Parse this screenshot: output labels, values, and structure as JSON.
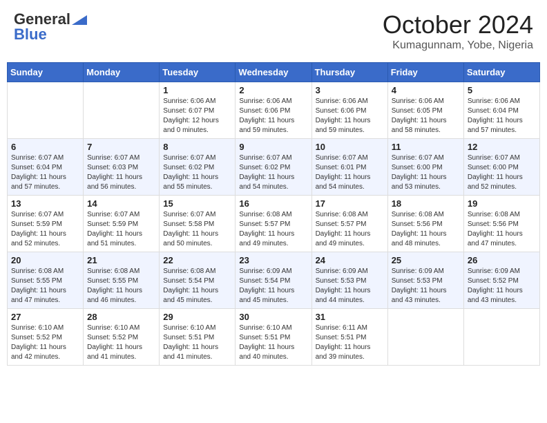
{
  "header": {
    "logo_general": "General",
    "logo_blue": "Blue",
    "month_title": "October 2024",
    "location": "Kumagunnam, Yobe, Nigeria"
  },
  "weekdays": [
    "Sunday",
    "Monday",
    "Tuesday",
    "Wednesday",
    "Thursday",
    "Friday",
    "Saturday"
  ],
  "weeks": [
    [
      {
        "day": "",
        "info": ""
      },
      {
        "day": "",
        "info": ""
      },
      {
        "day": "1",
        "info": "Sunrise: 6:06 AM\nSunset: 6:07 PM\nDaylight: 12 hours\nand 0 minutes."
      },
      {
        "day": "2",
        "info": "Sunrise: 6:06 AM\nSunset: 6:06 PM\nDaylight: 11 hours\nand 59 minutes."
      },
      {
        "day": "3",
        "info": "Sunrise: 6:06 AM\nSunset: 6:06 PM\nDaylight: 11 hours\nand 59 minutes."
      },
      {
        "day": "4",
        "info": "Sunrise: 6:06 AM\nSunset: 6:05 PM\nDaylight: 11 hours\nand 58 minutes."
      },
      {
        "day": "5",
        "info": "Sunrise: 6:06 AM\nSunset: 6:04 PM\nDaylight: 11 hours\nand 57 minutes."
      }
    ],
    [
      {
        "day": "6",
        "info": "Sunrise: 6:07 AM\nSunset: 6:04 PM\nDaylight: 11 hours\nand 57 minutes."
      },
      {
        "day": "7",
        "info": "Sunrise: 6:07 AM\nSunset: 6:03 PM\nDaylight: 11 hours\nand 56 minutes."
      },
      {
        "day": "8",
        "info": "Sunrise: 6:07 AM\nSunset: 6:02 PM\nDaylight: 11 hours\nand 55 minutes."
      },
      {
        "day": "9",
        "info": "Sunrise: 6:07 AM\nSunset: 6:02 PM\nDaylight: 11 hours\nand 54 minutes."
      },
      {
        "day": "10",
        "info": "Sunrise: 6:07 AM\nSunset: 6:01 PM\nDaylight: 11 hours\nand 54 minutes."
      },
      {
        "day": "11",
        "info": "Sunrise: 6:07 AM\nSunset: 6:00 PM\nDaylight: 11 hours\nand 53 minutes."
      },
      {
        "day": "12",
        "info": "Sunrise: 6:07 AM\nSunset: 6:00 PM\nDaylight: 11 hours\nand 52 minutes."
      }
    ],
    [
      {
        "day": "13",
        "info": "Sunrise: 6:07 AM\nSunset: 5:59 PM\nDaylight: 11 hours\nand 52 minutes."
      },
      {
        "day": "14",
        "info": "Sunrise: 6:07 AM\nSunset: 5:59 PM\nDaylight: 11 hours\nand 51 minutes."
      },
      {
        "day": "15",
        "info": "Sunrise: 6:07 AM\nSunset: 5:58 PM\nDaylight: 11 hours\nand 50 minutes."
      },
      {
        "day": "16",
        "info": "Sunrise: 6:08 AM\nSunset: 5:57 PM\nDaylight: 11 hours\nand 49 minutes."
      },
      {
        "day": "17",
        "info": "Sunrise: 6:08 AM\nSunset: 5:57 PM\nDaylight: 11 hours\nand 49 minutes."
      },
      {
        "day": "18",
        "info": "Sunrise: 6:08 AM\nSunset: 5:56 PM\nDaylight: 11 hours\nand 48 minutes."
      },
      {
        "day": "19",
        "info": "Sunrise: 6:08 AM\nSunset: 5:56 PM\nDaylight: 11 hours\nand 47 minutes."
      }
    ],
    [
      {
        "day": "20",
        "info": "Sunrise: 6:08 AM\nSunset: 5:55 PM\nDaylight: 11 hours\nand 47 minutes."
      },
      {
        "day": "21",
        "info": "Sunrise: 6:08 AM\nSunset: 5:55 PM\nDaylight: 11 hours\nand 46 minutes."
      },
      {
        "day": "22",
        "info": "Sunrise: 6:08 AM\nSunset: 5:54 PM\nDaylight: 11 hours\nand 45 minutes."
      },
      {
        "day": "23",
        "info": "Sunrise: 6:09 AM\nSunset: 5:54 PM\nDaylight: 11 hours\nand 45 minutes."
      },
      {
        "day": "24",
        "info": "Sunrise: 6:09 AM\nSunset: 5:53 PM\nDaylight: 11 hours\nand 44 minutes."
      },
      {
        "day": "25",
        "info": "Sunrise: 6:09 AM\nSunset: 5:53 PM\nDaylight: 11 hours\nand 43 minutes."
      },
      {
        "day": "26",
        "info": "Sunrise: 6:09 AM\nSunset: 5:52 PM\nDaylight: 11 hours\nand 43 minutes."
      }
    ],
    [
      {
        "day": "27",
        "info": "Sunrise: 6:10 AM\nSunset: 5:52 PM\nDaylight: 11 hours\nand 42 minutes."
      },
      {
        "day": "28",
        "info": "Sunrise: 6:10 AM\nSunset: 5:52 PM\nDaylight: 11 hours\nand 41 minutes."
      },
      {
        "day": "29",
        "info": "Sunrise: 6:10 AM\nSunset: 5:51 PM\nDaylight: 11 hours\nand 41 minutes."
      },
      {
        "day": "30",
        "info": "Sunrise: 6:10 AM\nSunset: 5:51 PM\nDaylight: 11 hours\nand 40 minutes."
      },
      {
        "day": "31",
        "info": "Sunrise: 6:11 AM\nSunset: 5:51 PM\nDaylight: 11 hours\nand 39 minutes."
      },
      {
        "day": "",
        "info": ""
      },
      {
        "day": "",
        "info": ""
      }
    ]
  ]
}
